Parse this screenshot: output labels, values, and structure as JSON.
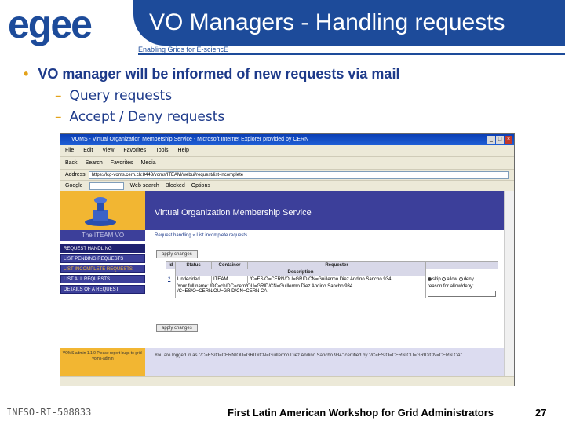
{
  "header": {
    "logo_text": "egee",
    "title": "VO Managers - Handling requests",
    "tagline": "Enabling Grids for E-sciencE"
  },
  "bullets": {
    "main": "VO manager will be informed of new requests via mail",
    "sub1": "Query requests",
    "sub2": "Accept / Deny requests"
  },
  "browser": {
    "title": "VOMS - Virtual Organization Membership Service - Microsoft Internet Explorer provided by CERN",
    "menu": [
      "File",
      "Edit",
      "View",
      "Favorites",
      "Tools",
      "Help"
    ],
    "toolbar": [
      "Back",
      "Search",
      "Favorites",
      "Media"
    ],
    "address_label": "Address",
    "address": "https://lcg-voms.cern.ch:8443/voms/ITEAM/webui/request/list-incomplete",
    "google_label": "Google",
    "google_items": [
      "Web search",
      "Blocked",
      "Options"
    ],
    "page": {
      "banner": "Virtual Organization Membership Service",
      "vo_name": "The ITEAM VO",
      "nav": [
        "REQUEST HANDLING",
        "LIST PENDING REQUESTS",
        "LIST INCOMPLETE REQUESTS",
        "LIST ALL REQUESTS",
        "DETAILS OF A REQUEST"
      ],
      "breadcrumb": "Request handling » List incomplete requests",
      "apply_label": "apply changes",
      "table_headers": [
        "Id",
        "Status",
        "Container",
        "Requester"
      ],
      "description_header": "Description",
      "request": {
        "id": "2",
        "status": "Undecided",
        "container": "ITEAM",
        "requester": "/C=ES/O=CERN/OU=GRID/CN=Guillermo Diez Andino Sancho 934",
        "description": "Your full name: /DC=ch/DC=cern/OU=GRID/CN=Guillermo Diez Andino Sancho 934 /C=ES/O=CERN/OU=GRID/CN=CERN CA",
        "options": [
          "skip",
          "allow",
          "deny"
        ],
        "reason_label": "reason for allow/deny:"
      },
      "login_info": "You are logged in as \"/C=ES/O=CERN/OU=GRID/CN=Guillermo Diez Andino Sancho 934\" certified by \"/C=ES/O=CERN/OU=GRID/CN=CERN CA\"",
      "left_footer": "VOMS admin 1.1.0 Please report bugs to grid-voms-admin"
    }
  },
  "footer": {
    "left": "INFSO-RI-508833",
    "middle": "First Latin American Workshop for Grid Administrators",
    "page_number": "27"
  }
}
